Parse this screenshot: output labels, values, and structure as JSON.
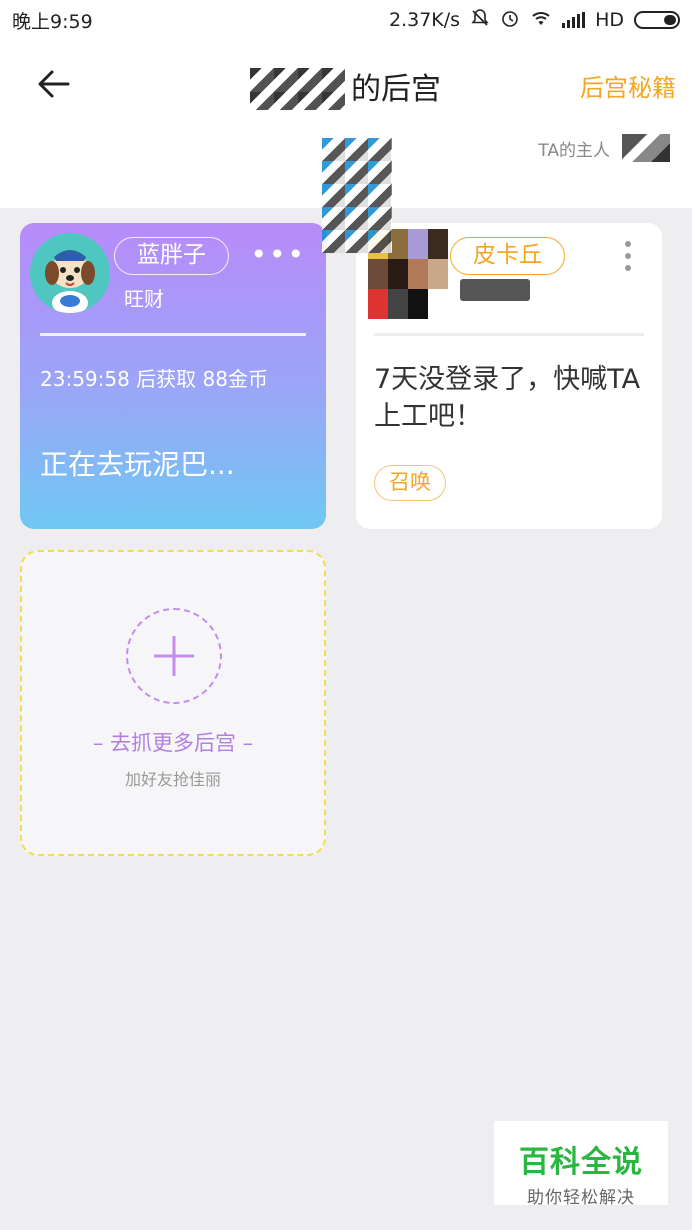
{
  "status_bar": {
    "time": "晚上9:59",
    "network_speed": "2.37K/s",
    "network_type": "HD",
    "icons": [
      "mute-icon",
      "alarm-icon",
      "wifi-icon",
      "signal-icon",
      "battery-icon"
    ]
  },
  "header": {
    "title": "的后宫",
    "right_link": "后宫秘籍",
    "owner_label": "TA的主人",
    "back_icon": "arrow-left-icon"
  },
  "cards": [
    {
      "name": "蓝胖子",
      "pet_name": "旺财",
      "reward_text": "23:59:58 后获取 88金币",
      "status_text": "正在去玩泥巴...",
      "more_icon": "more-horizontal-icon"
    },
    {
      "name": "皮卡丘",
      "idle_text": "7天没登录了，快喊TA上工吧！",
      "action_label": "召唤",
      "more_icon": "more-vertical-icon"
    }
  ],
  "add_card": {
    "label": "– 去抓更多后宫 –",
    "sublabel": "加好友抢佳丽",
    "icon": "plus-icon"
  },
  "watermark": {
    "title": "百科全说",
    "subtitle": "助你轻松解决"
  },
  "colors": {
    "accent_orange": "#f5a623",
    "card_gradient_top": "#b88bfa",
    "card_gradient_bottom": "#6fc8f3",
    "add_accent_purple": "#b47fe3",
    "dashed_yellow": "#f2dc4f",
    "watermark_green": "#2bb640"
  }
}
